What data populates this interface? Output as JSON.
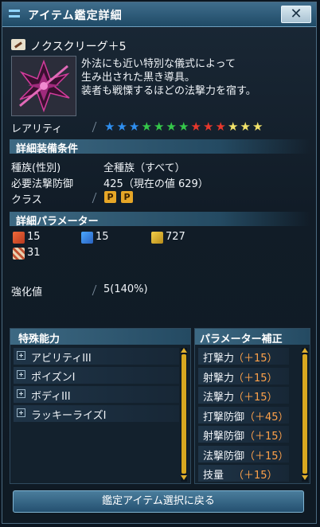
{
  "window": {
    "title": "アイテム鑑定詳細",
    "close_icon": "close-icon"
  },
  "item": {
    "name": "ノクスクリーグ＋5",
    "description": [
      "外法にも近い特別な儀式によって",
      "生み出された黒き導具。",
      "装者も戦慄するほどの法撃力を宿す。"
    ]
  },
  "rarity": {
    "label": "レアリティ",
    "stars": 13,
    "star_colors": [
      "#2f8ff0",
      "#2f8ff0",
      "#2f8ff0",
      "#35c84a",
      "#35c84a",
      "#35c84a",
      "#35c84a",
      "#e8382c",
      "#e8382c",
      "#e8382c",
      "#f2e36a",
      "#f2e36a",
      "#f2e36a"
    ]
  },
  "equip_conditions": {
    "header": "詳細装備条件",
    "race_label": "種族(性別)",
    "race_value": "全種族（すべて）",
    "req_label": "必要法撃防御",
    "req_value": "425（現在の値 629）",
    "class_label": "クラス",
    "class_badges": [
      "P",
      "P"
    ]
  },
  "params": {
    "header": "詳細パラメーター",
    "items": [
      {
        "icon": "striking-attack-icon",
        "value": "15"
      },
      {
        "icon": "ranged-attack-icon",
        "value": "15"
      },
      {
        "icon": "technique-attack-icon",
        "value": "727"
      },
      {
        "icon": "dexterity-icon",
        "value": "31"
      }
    ]
  },
  "grind": {
    "label": "強化値",
    "value": "5(140%)"
  },
  "abilities": {
    "header": "特殊能力",
    "items": [
      "アビリティIII",
      "ポイズンI",
      "ボディIII",
      "ラッキーライズI"
    ]
  },
  "bonus": {
    "header": "パラメーター補正",
    "items": [
      {
        "label": "打撃力",
        "value": "（＋15）"
      },
      {
        "label": "射撃力",
        "value": "（＋15）"
      },
      {
        "label": "法撃力",
        "value": "（＋15）"
      },
      {
        "label": "打撃防御",
        "value": "（＋45）"
      },
      {
        "label": "射撃防御",
        "value": "（＋15）"
      },
      {
        "label": "法撃防御",
        "value": "（＋15）"
      },
      {
        "label": "技量",
        "value": "（＋15）"
      }
    ]
  },
  "footer": {
    "button_label": "鑑定アイテム選択に戻る"
  }
}
